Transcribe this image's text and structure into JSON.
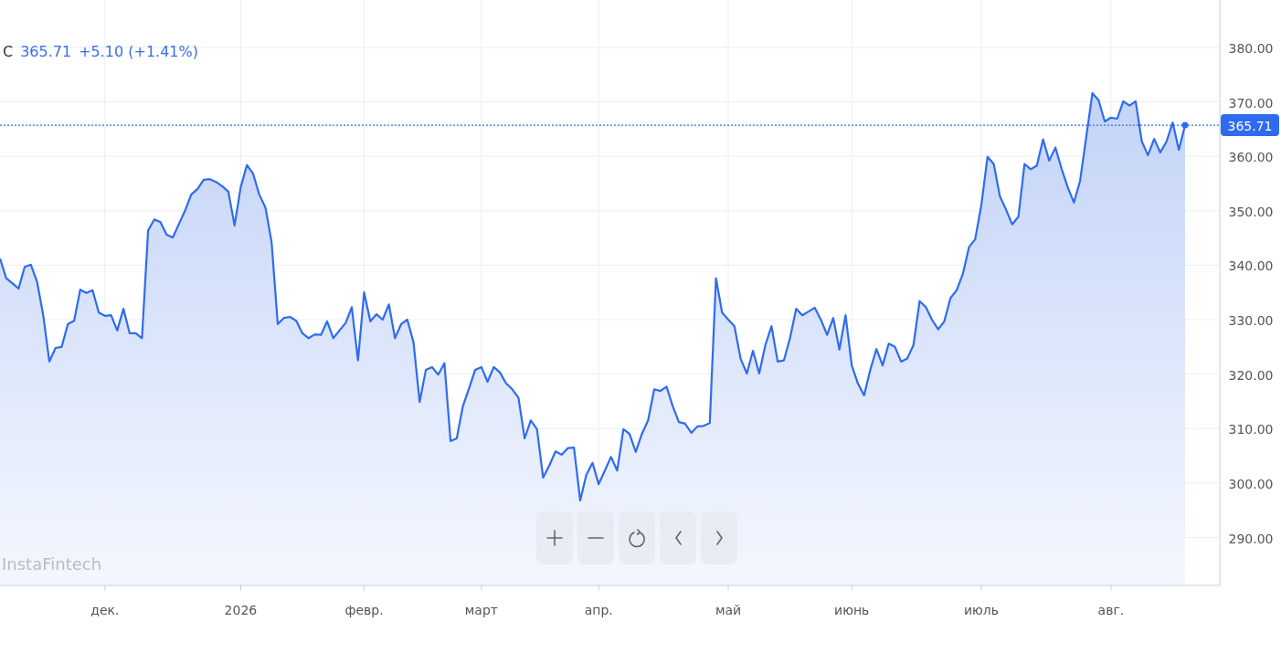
{
  "legend": {
    "price": "365.71",
    "change": "+5.10 (+1.41%)"
  },
  "brand_text": "InstaFintech",
  "controls": [
    {
      "kind": "zoom-in"
    },
    {
      "kind": "zoom-out"
    },
    {
      "kind": "reset"
    },
    {
      "kind": "back"
    },
    {
      "kind": "forward"
    }
  ],
  "chart_data": {
    "type": "area",
    "grid": true,
    "categories": [
      null,
      null,
      null,
      null,
      null,
      null,
      null,
      null,
      null,
      null,
      null,
      null,
      null,
      null,
      null,
      null,
      null,
      "дек.",
      null,
      null,
      null,
      null,
      null,
      null,
      null,
      null,
      null,
      null,
      null,
      null,
      null,
      null,
      null,
      null,
      null,
      null,
      null,
      null,
      null,
      "2026",
      null,
      null,
      null,
      null,
      null,
      null,
      null,
      null,
      null,
      null,
      null,
      null,
      null,
      null,
      null,
      null,
      null,
      null,
      null,
      "февр.",
      null,
      null,
      null,
      null,
      null,
      null,
      null,
      null,
      null,
      null,
      null,
      null,
      null,
      null,
      null,
      null,
      null,
      null,
      "март",
      null,
      null,
      null,
      null,
      null,
      null,
      null,
      null,
      null,
      null,
      null,
      null,
      null,
      null,
      null,
      null,
      null,
      null,
      "апр.",
      null,
      null,
      null,
      null,
      null,
      null,
      null,
      null,
      null,
      null,
      null,
      null,
      null,
      null,
      null,
      null,
      null,
      null,
      null,
      null,
      "май",
      null,
      null,
      null,
      null,
      null,
      null,
      null,
      null,
      null,
      null,
      null,
      null,
      null,
      null,
      null,
      null,
      null,
      null,
      null,
      "июнь",
      null,
      null,
      null,
      null,
      null,
      null,
      null,
      null,
      null,
      null,
      null,
      null,
      null,
      null,
      null,
      null,
      null,
      null,
      null,
      null,
      "июль",
      null,
      null,
      null,
      null,
      null,
      null,
      null,
      null,
      null,
      null,
      null,
      null,
      null,
      null,
      null,
      null,
      null,
      null,
      null,
      null,
      "авг.",
      null,
      null,
      null,
      null,
      null,
      null,
      null,
      null,
      null,
      null,
      null,
      null
    ],
    "ref_lines": [
      {
        "axis": "y",
        "value": 365.71,
        "label": "365.71"
      }
    ],
    "series": [
      {
        "name": "C",
        "color": "#2f6bf0",
        "values": [
          341.2,
          337.6,
          336.7,
          335.7,
          339.7,
          340.1,
          337.0,
          330.8,
          322.3,
          324.8,
          325.0,
          329.2,
          329.8,
          335.5,
          334.9,
          335.4,
          331.3,
          330.7,
          330.8,
          328.0,
          332.0,
          327.5,
          327.5,
          326.6,
          346.4,
          348.4,
          347.9,
          345.6,
          345.1,
          347.6,
          350.1,
          353.0,
          354.0,
          355.7,
          355.8,
          355.3,
          354.5,
          353.5,
          347.3,
          354.3,
          358.4,
          356.8,
          353.0,
          350.6,
          344.3,
          329.2,
          330.3,
          330.5,
          329.8,
          327.5,
          326.6,
          327.3,
          327.2,
          329.7,
          326.6,
          328.0,
          329.4,
          332.3,
          322.5,
          335.0,
          329.7,
          331.0,
          330.0,
          332.8,
          326.6,
          329.2,
          330.0,
          325.8,
          314.9,
          320.8,
          321.3,
          319.9,
          322.0,
          307.7,
          308.2,
          314.1,
          317.4,
          320.8,
          321.3,
          318.6,
          321.3,
          320.3,
          318.3,
          317.2,
          315.7,
          308.2,
          311.5,
          309.9,
          301.0,
          303.2,
          305.8,
          305.2,
          306.4,
          306.5,
          296.8,
          301.5,
          303.7,
          299.8,
          302.3,
          304.8,
          302.3,
          309.9,
          309.0,
          305.7,
          309.0,
          311.5,
          317.2,
          316.9,
          317.7,
          314.1,
          311.2,
          310.9,
          309.2,
          310.4,
          310.5,
          311.0,
          337.6,
          331.3,
          330.0,
          328.8,
          322.8,
          320.1,
          324.3,
          320.1,
          325.3,
          328.8,
          322.3,
          322.5,
          326.6,
          332.0,
          330.8,
          331.5,
          332.2,
          330.0,
          327.2,
          330.3,
          324.5,
          330.8,
          321.6,
          318.3,
          316.1,
          320.8,
          324.6,
          321.6,
          325.6,
          325.0,
          322.3,
          322.9,
          325.3,
          333.4,
          332.3,
          330.0,
          328.2,
          329.7,
          334.0,
          335.4,
          338.4,
          343.3,
          344.8,
          351.0,
          359.9,
          358.6,
          352.7,
          350.2,
          347.5,
          348.9,
          358.6,
          357.6,
          358.3,
          363.1,
          359.2,
          361.6,
          357.7,
          354.3,
          351.5,
          355.5,
          363.6,
          371.6,
          370.3,
          366.4,
          367.1,
          366.9,
          370.1,
          369.3,
          370.1,
          362.7,
          360.2,
          363.2,
          360.7,
          362.7,
          366.2,
          361.2,
          365.71
        ]
      }
    ],
    "ylim": [
      281.2,
      388.7
    ],
    "yticks": [
      {
        "value": 290,
        "label": "290.00"
      },
      {
        "value": 300,
        "label": "300.00"
      },
      {
        "value": 310,
        "label": "310.00"
      },
      {
        "value": 320,
        "label": "320.00"
      },
      {
        "value": 330,
        "label": "330.00"
      },
      {
        "value": 340,
        "label": "340.00"
      },
      {
        "value": 350,
        "label": "350.00"
      },
      {
        "value": 360,
        "label": "360.00"
      },
      {
        "value": 370,
        "label": "370.00"
      },
      {
        "value": 380,
        "label": "380.00"
      }
    ]
  }
}
